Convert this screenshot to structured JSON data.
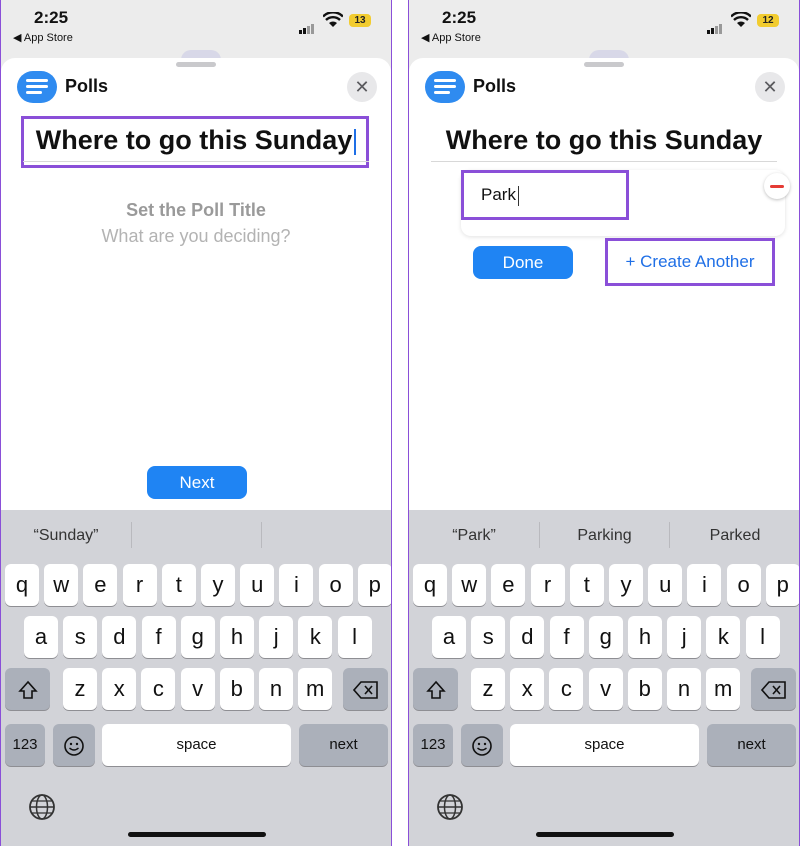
{
  "phones": [
    {
      "status": {
        "time": "2:25",
        "back_label": "App Store",
        "battery": "13"
      },
      "app": {
        "name": "Polls"
      },
      "title": "Where to go this Sunday",
      "hint_title": "Set the Poll Title",
      "hint_sub": "What are you deciding?",
      "next_label": "Next",
      "suggestions": [
        "“Sunday”",
        "",
        ""
      ]
    },
    {
      "status": {
        "time": "2:25",
        "back_label": "App Store",
        "battery": "12"
      },
      "app": {
        "name": "Polls"
      },
      "title": "Where to go this Sunday",
      "option_value": "Park",
      "done_label": "Done",
      "create_label": "+ Create Another",
      "suggestions": [
        "“Park”",
        "Parking",
        "Parked"
      ]
    }
  ],
  "keyboard": {
    "row1": [
      "q",
      "w",
      "e",
      "r",
      "t",
      "y",
      "u",
      "i",
      "o",
      "p"
    ],
    "row2": [
      "a",
      "s",
      "d",
      "f",
      "g",
      "h",
      "j",
      "k",
      "l"
    ],
    "row3": [
      "z",
      "x",
      "c",
      "v",
      "b",
      "n",
      "m"
    ],
    "numbers_key": "123",
    "space_key": "space",
    "next_key": "next",
    "shift_icon": "shift-icon",
    "delete_icon": "delete-icon",
    "emoji_icon": "emoji-icon",
    "globe_icon": "globe-icon"
  },
  "colors": {
    "accent": "#1f84f3",
    "highlight": "#8a4fd8",
    "delete": "#e53b35"
  }
}
